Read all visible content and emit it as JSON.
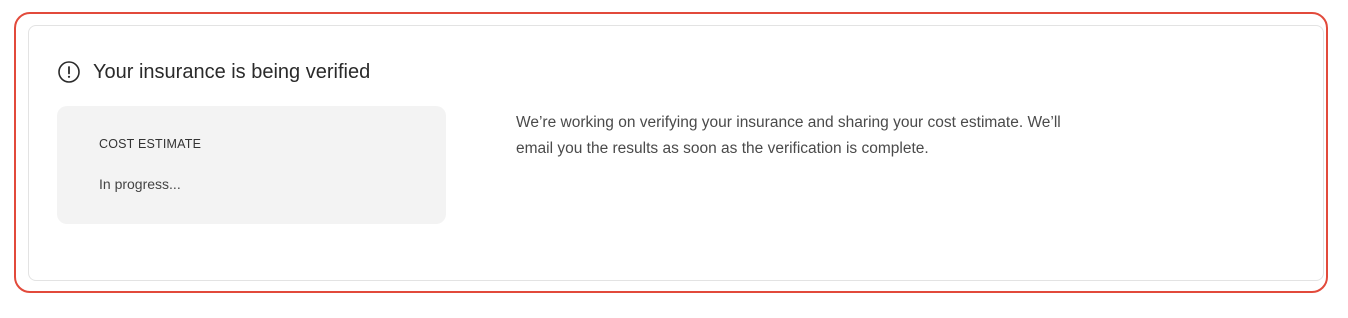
{
  "notice": {
    "icon": "exclamation-circle-icon",
    "title": "Your insurance is being verified"
  },
  "estimate": {
    "label": "COST ESTIMATE",
    "status": "In progress..."
  },
  "message": {
    "text": "We’re working on verifying your insurance and sharing your cost estimate.  We’ll\nemail you the results as soon as the verification is complete."
  },
  "colors": {
    "highlight_border": "#e24a3b",
    "panel_background": "#f3f3f3",
    "text_primary": "#2a2a2a"
  }
}
